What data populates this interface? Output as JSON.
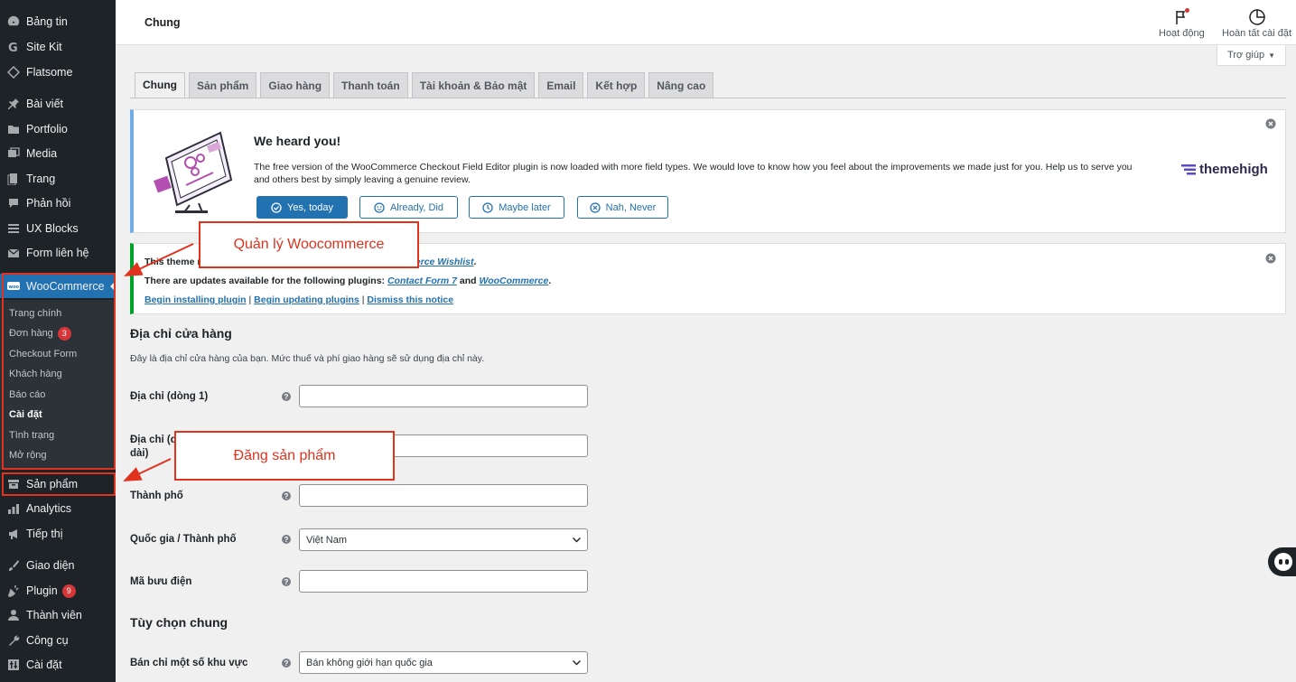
{
  "sidebar": {
    "items": [
      {
        "label": "Bảng tin",
        "icon": "dashboard-icon"
      },
      {
        "label": "Site Kit",
        "icon": "google-g-icon"
      },
      {
        "label": "Flatsome",
        "icon": "flatsome-diamond-icon"
      },
      {
        "label": "Bài viết",
        "icon": "pin-icon"
      },
      {
        "label": "Portfolio",
        "icon": "folder-icon"
      },
      {
        "label": "Media",
        "icon": "media-icon"
      },
      {
        "label": "Trang",
        "icon": "page-icon"
      },
      {
        "label": "Phản hồi",
        "icon": "comment-icon"
      },
      {
        "label": "UX Blocks",
        "icon": "blocks-icon"
      },
      {
        "label": "Form liên hệ",
        "icon": "mail-icon"
      },
      {
        "label": "WooCommerce",
        "icon": "woo-icon"
      },
      {
        "label": "Sản phẩm",
        "icon": "archive-icon"
      },
      {
        "label": "Analytics",
        "icon": "bar-chart-icon"
      },
      {
        "label": "Tiếp thị",
        "icon": "megaphone-icon"
      },
      {
        "label": "Giao diện",
        "icon": "brush-icon"
      },
      {
        "label": "Plugin",
        "icon": "plugin-icon",
        "badge": "9"
      },
      {
        "label": "Thành viên",
        "icon": "user-icon"
      },
      {
        "label": "Công cụ",
        "icon": "wrench-icon"
      },
      {
        "label": "Cài đặt",
        "icon": "settings-icon"
      }
    ],
    "woo_submenu": [
      {
        "label": "Trang chính"
      },
      {
        "label": "Đơn hàng",
        "badge": "3"
      },
      {
        "label": "Checkout Form"
      },
      {
        "label": "Khách hàng"
      },
      {
        "label": "Báo cáo"
      },
      {
        "label": "Cài đặt"
      },
      {
        "label": "Tình trạng"
      },
      {
        "label": "Mở rộng"
      }
    ]
  },
  "header": {
    "title": "Chung",
    "activity_label": "Hoạt động",
    "setup_label": "Hoàn tất cài đặt",
    "help_label": "Trợ giúp"
  },
  "tabs": [
    "Chung",
    "Sản phẩm",
    "Giao hàng",
    "Thanh toán",
    "Tài khoản & Bảo mật",
    "Email",
    "Kết hợp",
    "Nâng cao"
  ],
  "themehigh_notice": {
    "title": "We heard you!",
    "text": "The free version of the WooCommerce Checkout Field Editor plugin is now loaded with more field types. We would love to know how you feel about the improvements we made just for you. Help us to serve you and others best by simply leaving a genuine review.",
    "buttons": [
      "Yes, today",
      "Already, Did",
      "Maybe later",
      "Nah, Never"
    ],
    "logo_text": "themehigh"
  },
  "plugin_notice": {
    "line1_prefix": "This theme r",
    "line1_link": "merce Wishlist",
    "line1_suffix": ".",
    "line2_prefix": "There are updates available for the following plugins: ",
    "line2_link1": "Contact Form 7",
    "line2_and": " and ",
    "line2_link2": "WooCommerce",
    "line2_suffix": ".",
    "action_install": "Begin installing plugin",
    "action_update": "Begin updating plugins",
    "action_dismiss": "Dismiss this notice",
    "separator": " | "
  },
  "store_address": {
    "title": "Địa chỉ cửa hàng",
    "description": "Đây là địa chỉ cửa hàng của bạn. Mức thuế và phí giao hàng sẽ sử dụng địa chỉ này.",
    "fields": {
      "address1_label": "Địa chỉ (dòng 1)",
      "address2_label_line1": "Địa chỉ (d",
      "address2_label_line2": "dài)",
      "city_label": "Thành phố",
      "country_label": "Quốc gia / Thành phố",
      "country_value": "Việt Nam",
      "postcode_label": "Mã bưu điện"
    }
  },
  "general_options": {
    "title": "Tùy chọn chung",
    "sell_label": "Bán chỉ một số khu vực",
    "sell_value": "Bán không giới hạn quốc gia"
  },
  "annotations": {
    "woo_manage": "Quản lý Woocommerce",
    "post_product": "Đăng sản phẩm",
    "color": "#e0321c"
  },
  "colors": {
    "sidebar_bg": "#1d2327",
    "accent": "#2271b1",
    "badge": "#d63638"
  }
}
